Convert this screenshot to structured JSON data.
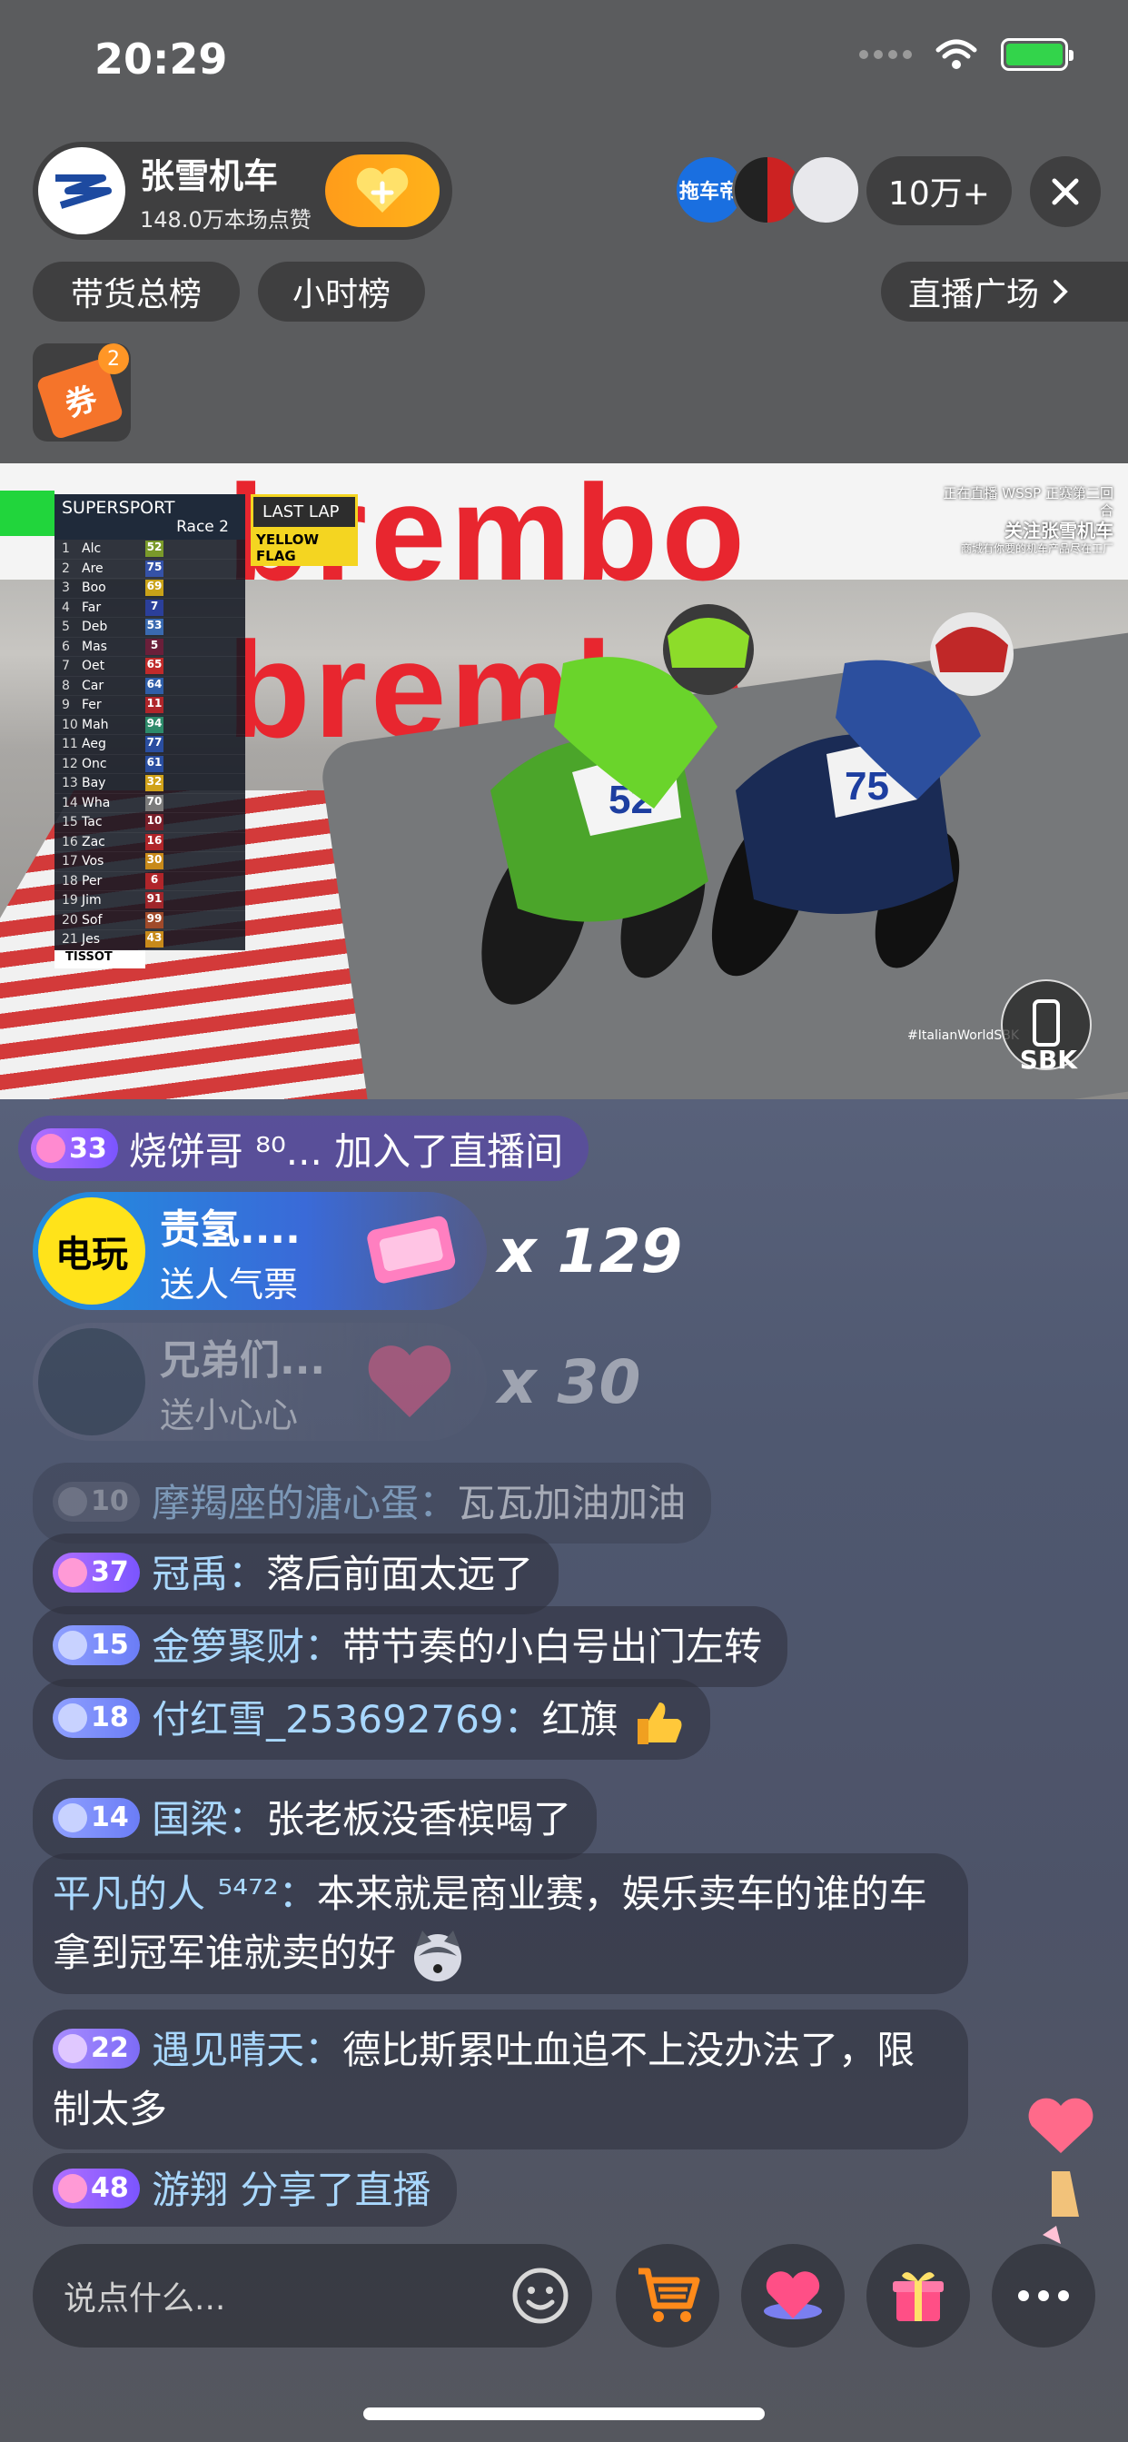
{
  "status_bar": {
    "time": "20:29"
  },
  "host": {
    "name": "张雪机车",
    "likes": "148.0万本场点赞"
  },
  "viewers": {
    "count": "10万+",
    "first_badge": "拖车帝"
  },
  "ranks": {
    "sales": "带货总榜",
    "hourly": "小时榜",
    "plaza": "直播广场"
  },
  "coupon": {
    "badge": "2",
    "label": "券"
  },
  "video": {
    "banner_text": "brembo brembo",
    "series": "SUPERSPORT",
    "race": "Race 2",
    "lap_status": "LAST LAP",
    "flag_status": "YELLOW FLAG",
    "overlay_title_1": "正在直播 WSSP 正赛第二回合",
    "overlay_title_2": "关注张雪机车",
    "overlay_title_3": "商城有你要的机车产品尽在工厂",
    "leaderboard": [
      {
        "pos": "1",
        "name": "Alc",
        "num": "52",
        "color": "#7a9a2a"
      },
      {
        "pos": "2",
        "name": "Are",
        "num": "75",
        "color": "#3552a8"
      },
      {
        "pos": "3",
        "name": "Boo",
        "num": "69",
        "color": "#c9a218"
      },
      {
        "pos": "4",
        "name": "Far",
        "num": "7",
        "color": "#2b3f9a"
      },
      {
        "pos": "5",
        "name": "Deb",
        "num": "53",
        "color": "#3a6ab0"
      },
      {
        "pos": "6",
        "name": "Mas",
        "num": "5",
        "color": "#6a1f3a"
      },
      {
        "pos": "7",
        "name": "Oet",
        "num": "65",
        "color": "#c02a2a"
      },
      {
        "pos": "8",
        "name": "Car",
        "num": "64",
        "color": "#2f5ea8"
      },
      {
        "pos": "9",
        "name": "Fer",
        "num": "11",
        "color": "#b0252a"
      },
      {
        "pos": "10",
        "name": "Mah",
        "num": "94",
        "color": "#2d8a6a"
      },
      {
        "pos": "11",
        "name": "Aeg",
        "num": "77",
        "color": "#2a4ea0"
      },
      {
        "pos": "12",
        "name": "Onc",
        "num": "61",
        "color": "#2a4ea0"
      },
      {
        "pos": "13",
        "name": "Bay",
        "num": "32",
        "color": "#d0a21a"
      },
      {
        "pos": "14",
        "name": "Wha",
        "num": "70",
        "color": "#7a7a7a"
      },
      {
        "pos": "15",
        "name": "Tac",
        "num": "10",
        "color": "#7a1f2a"
      },
      {
        "pos": "16",
        "name": "Zac",
        "num": "16",
        "color": "#b0252a"
      },
      {
        "pos": "17",
        "name": "Vos",
        "num": "30",
        "color": "#c88a1a"
      },
      {
        "pos": "18",
        "name": "Per",
        "num": "6",
        "color": "#b0252a"
      },
      {
        "pos": "19",
        "name": "Jim",
        "num": "91",
        "color": "#a0252a"
      },
      {
        "pos": "20",
        "name": "Sof",
        "num": "99",
        "color": "#a04a2a"
      },
      {
        "pos": "21",
        "name": "Jes",
        "num": "43",
        "color": "#c88a1a"
      }
    ],
    "sponsor": "TISSOT",
    "corner_tag": "#ItalianWorldSBK",
    "logo": "SBK",
    "rider1_number": "52",
    "rider2_number": "75"
  },
  "join_event": {
    "level": "33",
    "text": "烧饼哥 ⁸⁰... 加入了直播间"
  },
  "gifts": [
    {
      "avatar_text": "电玩",
      "user": "责氢....",
      "desc": "送人气票",
      "count": "x 129"
    },
    {
      "avatar_text": "",
      "user": "兄弟们...",
      "desc": "送小心心",
      "count": "x 30"
    }
  ],
  "messages": [
    {
      "level": "10",
      "user": "摩羯座的溏心蛋：",
      "text": "瓦瓦加油加油"
    },
    {
      "level": "37",
      "user": "冠禹：",
      "text": "落后前面太远了"
    },
    {
      "level": "15",
      "user": "金箩聚财：",
      "text": "带节奏的小白号出门左转"
    },
    {
      "level": "18",
      "user": "付红雪_253692769：",
      "text": "红旗"
    },
    {
      "level": "14",
      "user": "国梁：",
      "text": "张老板没香槟喝了"
    },
    {
      "level": "",
      "user": "平凡的人 ⁵⁴⁷²：",
      "text": "本来就是商业赛，娱乐卖车的谁的车拿到冠军谁就卖的好"
    },
    {
      "level": "22",
      "user": "遇见晴天：",
      "text": "德比斯累吐血追不上没办法了，限制太多"
    },
    {
      "level": "48",
      "user": "游翔",
      "text": "分享了直播"
    }
  ],
  "input": {
    "placeholder": "说点什么..."
  }
}
